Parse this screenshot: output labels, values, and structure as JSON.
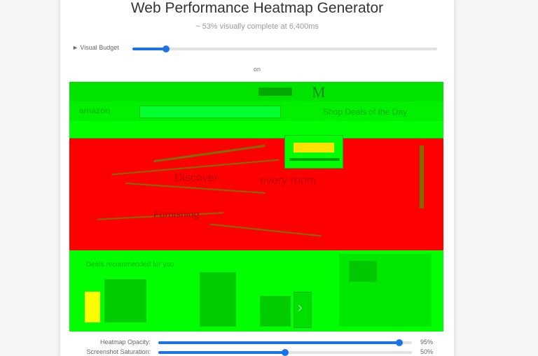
{
  "header": {
    "title": "Web Performance Heatmap Generator",
    "subtitle": "~ 53% visually complete at 6,400ms"
  },
  "visual_budget": {
    "label": "► Visual Budget",
    "value": 0.11
  },
  "filmstrip_label": "on",
  "heatmap": {
    "colors": {
      "fast": "#00ff00",
      "slow": "#ff0000",
      "mid": "#ffff00"
    },
    "page_text": {
      "brand": "amazon",
      "shop": "Shop Deals of the Day",
      "hero_a": "Discover",
      "hero_b": "every room",
      "hero_c": "Furnishing",
      "section": "Deals recommended for you"
    }
  },
  "controls": {
    "opacity": {
      "label": "Heatmap Opacity:",
      "value": 0.95,
      "display": "95%"
    },
    "saturation": {
      "label": "Screenshot Saturation:",
      "value": 0.5,
      "display": "50%"
    }
  },
  "accent": "#1a73e8"
}
